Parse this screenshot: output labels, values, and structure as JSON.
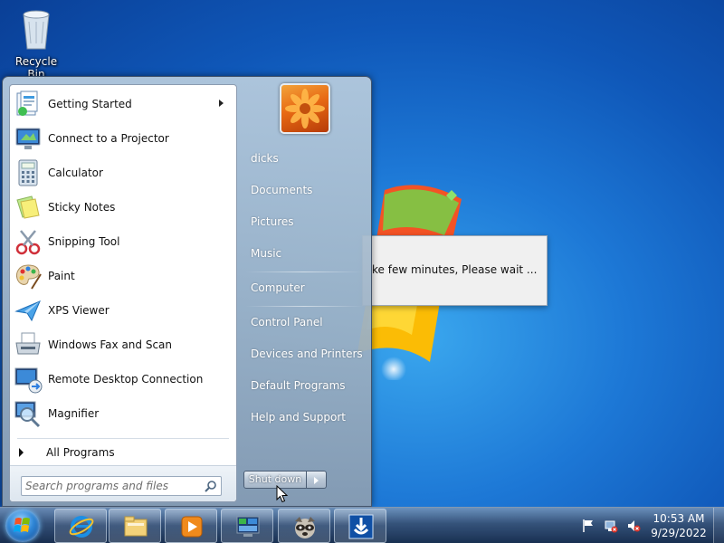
{
  "desktop": {
    "icons": [
      {
        "label": "Recycle Bin",
        "icon": "recycle-bin-icon"
      }
    ]
  },
  "background_dialog": {
    "message": "ke few minutes, Please wait ..."
  },
  "start_menu": {
    "programs": [
      {
        "label": "Getting Started",
        "icon": "getting-started-icon",
        "has_submenu": true
      },
      {
        "label": "Connect to a Projector",
        "icon": "projector-icon"
      },
      {
        "label": "Calculator",
        "icon": "calculator-icon"
      },
      {
        "label": "Sticky Notes",
        "icon": "sticky-notes-icon"
      },
      {
        "label": "Snipping Tool",
        "icon": "scissors-icon"
      },
      {
        "label": "Paint",
        "icon": "paint-palette-icon"
      },
      {
        "label": "XPS Viewer",
        "icon": "paper-plane-icon"
      },
      {
        "label": "Windows Fax and Scan",
        "icon": "fax-icon"
      },
      {
        "label": "Remote Desktop Connection",
        "icon": "remote-desktop-icon"
      },
      {
        "label": "Magnifier",
        "icon": "magnifier-icon"
      }
    ],
    "all_programs_label": "All Programs",
    "search": {
      "placeholder": "Search programs and files"
    },
    "right_items": [
      {
        "label": "dicks"
      },
      {
        "label": "Documents"
      },
      {
        "label": "Pictures"
      },
      {
        "label": "Music"
      },
      {
        "label": "Computer"
      },
      {
        "label": "Control Panel"
      },
      {
        "label": "Devices and Printers"
      },
      {
        "label": "Default Programs"
      },
      {
        "label": "Help and Support"
      }
    ],
    "shutdown_label": "Shut down"
  },
  "taskbar": {
    "pinned": [
      {
        "icon": "internet-explorer-icon"
      },
      {
        "icon": "file-explorer-icon"
      },
      {
        "icon": "media-player-icon"
      },
      {
        "icon": "control-panel-icon"
      },
      {
        "icon": "raccoon-app-icon"
      },
      {
        "icon": "installer-app-icon"
      }
    ],
    "tray_icons": [
      "action-center-flag-icon",
      "network-icon",
      "volume-muted-icon"
    ],
    "clock": {
      "time": "10:53 AM",
      "date": "9/29/2022"
    }
  }
}
